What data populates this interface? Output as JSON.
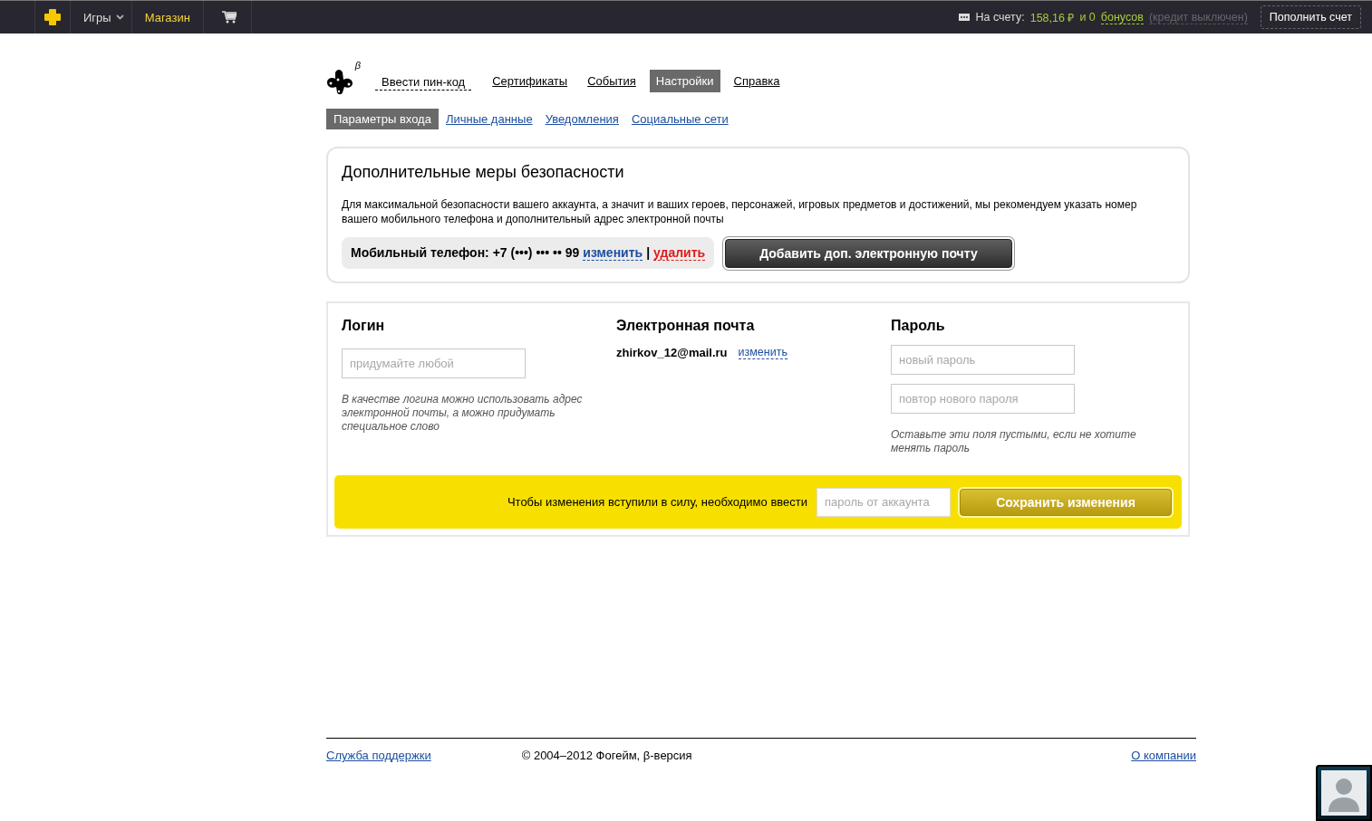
{
  "topbar": {
    "games_menu": "Игры",
    "shop": "Магазин",
    "account": {
      "label": "На счету:",
      "balance": "158,16 ₽",
      "and": "и 0",
      "bonuses": "бонусов",
      "credit": "(кредит выключен)"
    },
    "topup_button": "Пополнить счет"
  },
  "logo": {
    "badge": "β"
  },
  "main_nav": [
    {
      "label": "Ввести пин-код",
      "kind": "action",
      "selected": false
    },
    {
      "label": "Сертификаты",
      "kind": "link",
      "selected": false
    },
    {
      "label": "События",
      "kind": "link",
      "selected": false
    },
    {
      "label": "Настройки",
      "kind": "link",
      "selected": true
    },
    {
      "label": "Справка",
      "kind": "link",
      "selected": false
    }
  ],
  "sub_nav": [
    {
      "label": "Параметры входа",
      "selected": true
    },
    {
      "label": "Личные данные",
      "selected": false
    },
    {
      "label": "Уведомления",
      "selected": false
    },
    {
      "label": "Социальные сети",
      "selected": false
    }
  ],
  "security": {
    "title": "Дополнительные меры безопасности",
    "text": "Для максимальной безопасности вашего аккаунта, а значит и ваших героев, персонажей, игровых предметов и достижений, мы рекомендуем указать номер вашего мобильного телефона и дополнительный адрес электронной почты",
    "phone": "Мобильный телефон: +7 (•••) ••• •• 99",
    "change": "изменить",
    "separator": "|",
    "delete": "удалить",
    "add_email_button": "Добавить доп. электронную почту"
  },
  "login": {
    "heading": "Логин",
    "placeholder": "придумайте любой",
    "hint": "В качестве логина можно использовать адрес электронной почты, а можно придумать специальное слово"
  },
  "email": {
    "heading": "Электронная почта",
    "value": "zhirkov_12@mail.ru",
    "change": "изменить"
  },
  "password": {
    "heading": "Пароль",
    "placeholders": [
      "новый пароль",
      "повтор нового пароля"
    ],
    "hint": "Оставьте эти поля пустыми, если не хотите менять пароль"
  },
  "confirm": {
    "text": "Чтобы изменения вступили в силу, необходимо ввести",
    "placeholder": "пароль от аккаунта",
    "button": "Сохранить изменения"
  },
  "footer": {
    "support": "Служба поддержки",
    "copyright": "© 2004–2012 Фогейм, β-версия",
    "about": "О компании"
  }
}
